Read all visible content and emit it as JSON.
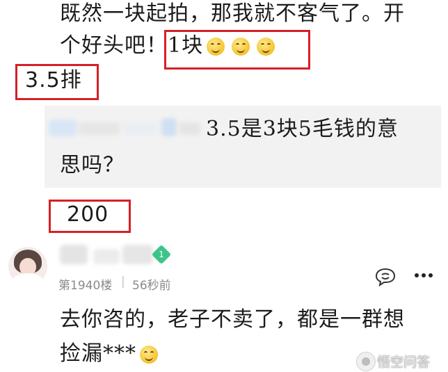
{
  "post": {
    "line1": "既然一块起拍，那我就不客气了。开",
    "line2_prefix": "个好头吧！",
    "line2_highlight": "1块"
  },
  "reply_1": {
    "text": "3.5排"
  },
  "quote": {
    "line1": "3.5是3块5毛钱的意",
    "line2": "思吗？"
  },
  "reply_2": {
    "text": "200"
  },
  "comment": {
    "floor": "第1940楼",
    "separator": "|",
    "time": "56秒前",
    "level_badge": "1",
    "line1": "去你咨的，老子不卖了，都是一群想",
    "line2": "捡漏***"
  },
  "watermark": {
    "text": "悟空问答"
  },
  "icons": {
    "smile": "smile-emoji-icon",
    "reply": "reply-icon",
    "more": "more-options-icon",
    "level": "level-badge-icon",
    "watermark": "wukong-logo-icon"
  },
  "colors": {
    "highlight_border": "#d61f26",
    "badge": "#3cc48b",
    "quote_bg": "#f2f2f2"
  }
}
